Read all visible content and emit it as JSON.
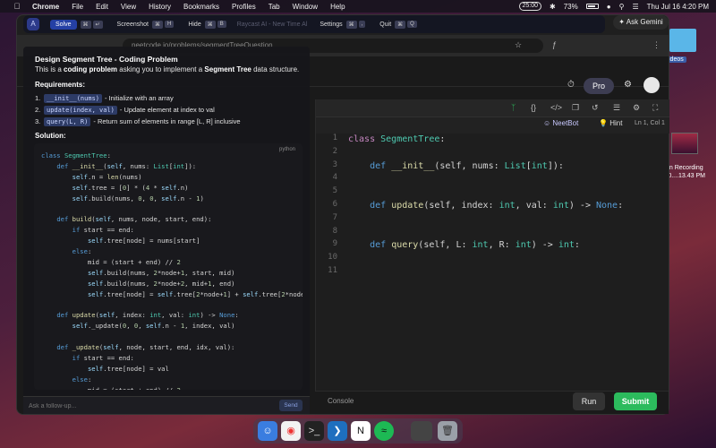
{
  "menubar": {
    "app_name": "Chrome",
    "menus": [
      "File",
      "Edit",
      "View",
      "History",
      "Bookmarks",
      "Profiles",
      "Tab",
      "Window",
      "Help"
    ],
    "timer": "25:00",
    "battery": "73%",
    "datetime": "Thu Jul 16  4:20 PM"
  },
  "desktop": {
    "folder_label": "ideos",
    "recording_label_line1": "en Recording",
    "recording_label_line2": "-0....13.43 PM"
  },
  "browser": {
    "url": "neetcode.io/problems/segmentTreeQuestion",
    "tab_hint": "Small"
  },
  "overlay_bar": {
    "solve_label": "Solve",
    "screenshot_label": "Screenshot",
    "hide_label": "Hide",
    "ghost_label": "Raycast AI - New Time Al",
    "settings_label": "Settings",
    "quit_label": "Quit"
  },
  "ask_gemini": "Ask Gemini",
  "panel": {
    "title": "Design Segment Tree - Coding Problem",
    "desc_prefix": "This is a ",
    "desc_bold1": "coding problem",
    "desc_mid": " asking you to implement a ",
    "desc_bold2": "Segment Tree",
    "desc_suffix": " data structure.",
    "requirements_heading": "Requirements:",
    "requirements": [
      {
        "num": "1.",
        "code": "__init__(nums)",
        "text": "- Initialize with an array"
      },
      {
        "num": "2.",
        "code": "update(index, val)",
        "text": "- Update element at index to val"
      },
      {
        "num": "3.",
        "code": "query(L, R)",
        "text": "- Return sum of elements in range [L, R] inclusive"
      }
    ],
    "solution_heading": "Solution:",
    "solution_lang": "python",
    "followup_placeholder": "Ask a follow-up...",
    "send_label": "Send"
  },
  "editor": {
    "neetbot_label": "NeetBot",
    "hint_label": "Hint",
    "cursor_position": "Ln 1, Col 1",
    "line_numbers": [
      "1",
      "2",
      "3",
      "4",
      "5",
      "6",
      "7",
      "8",
      "9",
      "10",
      "11"
    ],
    "console_label": "Console",
    "run_label": "Run",
    "submit_label": "Submit"
  },
  "nav": {
    "pro_label": "Pro"
  }
}
